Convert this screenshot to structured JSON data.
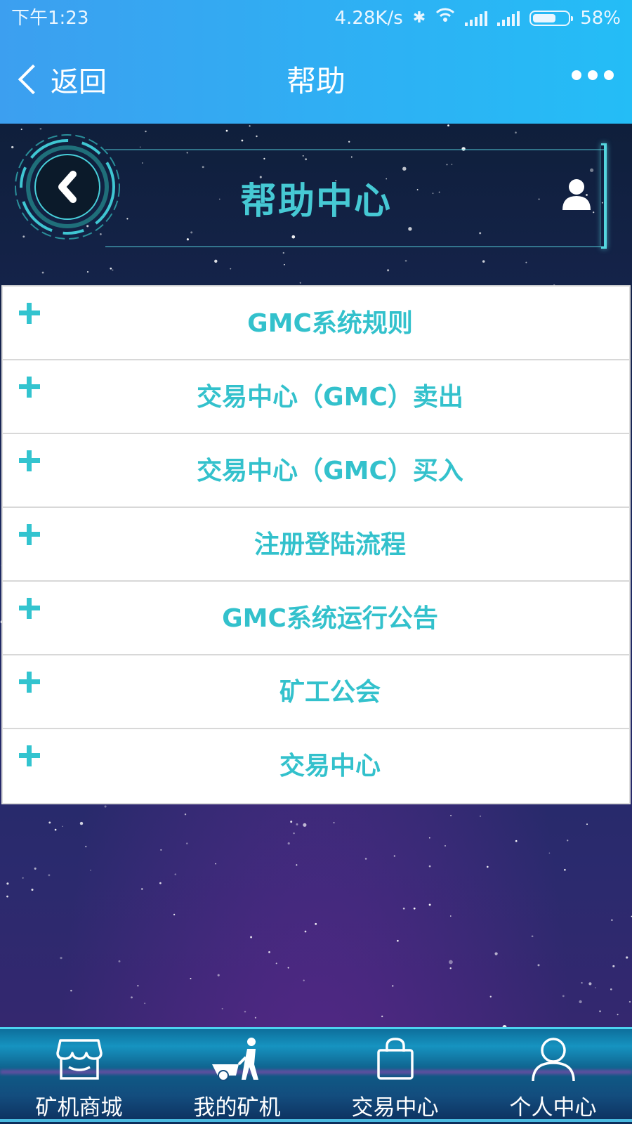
{
  "status_bar": {
    "time": "下午1:23",
    "network_speed": "4.28K/s",
    "battery": "58%"
  },
  "header": {
    "back_label": "返回",
    "title": "帮助"
  },
  "help_center": {
    "title": "帮助中心"
  },
  "help_items": [
    {
      "label": "GMC系统规则"
    },
    {
      "label": "交易中心（GMC）卖出"
    },
    {
      "label": "交易中心（GMC）买入"
    },
    {
      "label": "注册登陆流程"
    },
    {
      "label": "GMC系统运行公告"
    },
    {
      "label": "矿工公会"
    },
    {
      "label": "交易中心"
    }
  ],
  "bottom_nav": [
    {
      "label": "矿机商城",
      "icon": "store-icon"
    },
    {
      "label": "我的矿机",
      "icon": "miner-icon"
    },
    {
      "label": "交易中心",
      "icon": "shopping-bag-icon"
    },
    {
      "label": "个人中心",
      "icon": "person-icon"
    }
  ],
  "colors": {
    "accent": "#33c1cc",
    "header_blue": "#3c9ff0",
    "header_cyan": "#24bdf6"
  }
}
